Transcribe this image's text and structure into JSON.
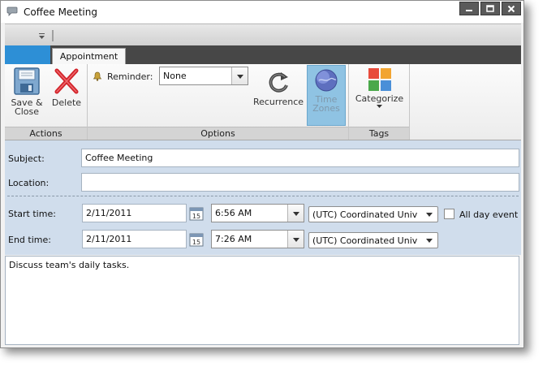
{
  "window": {
    "title": "Coffee Meeting"
  },
  "ribbon": {
    "tab_label": "Appointment",
    "groups": {
      "actions": {
        "label": "Actions",
        "save_close_line1": "Save &",
        "save_close_line2": "Close",
        "delete_label": "Delete"
      },
      "options": {
        "label": "Options",
        "reminder_label": "Reminder:",
        "reminder_value": "None",
        "recurrence_label": "Recurrence",
        "time_zones_line1": "Time",
        "time_zones_line2": "Zones"
      },
      "tags": {
        "label": "Tags",
        "categorize_label": "Categorize"
      }
    }
  },
  "form": {
    "subject_label": "Subject:",
    "subject_value": "Coffee Meeting",
    "location_label": "Location:",
    "location_value": "",
    "start_label": "Start time:",
    "start_date": "2/11/2011",
    "start_time": "6:56 AM",
    "start_timezone": "(UTC) Coordinated Univ",
    "end_label": "End time:",
    "end_date": "2/11/2011",
    "end_time": "7:26 AM",
    "end_timezone": "(UTC) Coordinated Univ",
    "all_day_label": "All day event",
    "calendar_day": "15"
  },
  "notes": {
    "text": "Discuss team's daily tasks."
  },
  "colors": {
    "accent": "#2d8fd6",
    "tabbar": "#474747",
    "form_bg": "#d0ddec",
    "time_zones_highlight": "#8fc3e3"
  },
  "icons": [
    "chat-bubble-icon",
    "minimize-icon",
    "maximize-icon",
    "close-icon",
    "save-icon",
    "delete-icon",
    "bell-icon",
    "recurrence-icon",
    "globe-icon",
    "categorize-icon",
    "calendar-icon"
  ]
}
